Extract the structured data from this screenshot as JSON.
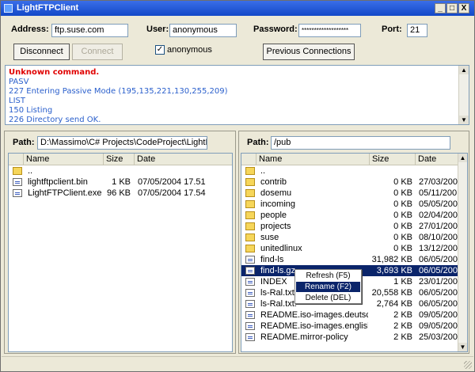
{
  "window": {
    "title": "LightFTPClient",
    "controls": {
      "minimize": "_",
      "maximize": "□",
      "close": "X"
    }
  },
  "connection": {
    "address_label": "Address:",
    "address_value": "ftp.suse.com",
    "user_label": "User:",
    "user_value": "anonymous",
    "password_label": "Password:",
    "password_value": "*******************",
    "port_label": "Port:",
    "port_value": "21",
    "anonymous_label": "anonymous",
    "anonymous_checked": "✓",
    "disconnect_label": "Disconnect",
    "connect_label": "Connect",
    "previous_label": "Previous Connections"
  },
  "log": [
    {
      "text": "Unknown command.",
      "color": "#e00000",
      "bold": true
    },
    {
      "text": "PASV",
      "color": "#2a5fcc",
      "bold": false
    },
    {
      "text": "227 Entering Passive Mode (195,135,221,130,255,209)",
      "color": "#2a5fcc",
      "bold": false
    },
    {
      "text": "LIST",
      "color": "#2a5fcc",
      "bold": false
    },
    {
      "text": "150 Listing",
      "color": "#2a5fcc",
      "bold": false
    },
    {
      "text": "226 Directory send OK.",
      "color": "#2a5fcc",
      "bold": false
    }
  ],
  "local": {
    "path_label": "Path:",
    "path_value": "D:\\Massimo\\C# Projects\\CodeProject\\LightFTPClient\\",
    "columns": [
      "Name",
      "Size",
      "Date"
    ],
    "rows": [
      {
        "icon": "folder",
        "name": "..",
        "size": "",
        "date": ""
      },
      {
        "icon": "file",
        "name": "lightftpclient.bin",
        "size": "1 KB",
        "date": "07/05/2004 17.51"
      },
      {
        "icon": "file",
        "name": "LightFTPClient.exe",
        "size": "96 KB",
        "date": "07/05/2004 17.54"
      }
    ]
  },
  "remote": {
    "path_label": "Path:",
    "path_value": "/pub",
    "columns": [
      "Name",
      "Size",
      "Date"
    ],
    "rows": [
      {
        "icon": "folder",
        "name": "..",
        "size": "",
        "date": ""
      },
      {
        "icon": "folder",
        "name": "contrib",
        "size": "0 KB",
        "date": "27/03/200"
      },
      {
        "icon": "folder",
        "name": "dosemu",
        "size": "0 KB",
        "date": "05/11/200"
      },
      {
        "icon": "folder",
        "name": "incoming",
        "size": "0 KB",
        "date": "05/05/200"
      },
      {
        "icon": "folder",
        "name": "people",
        "size": "0 KB",
        "date": "02/04/200"
      },
      {
        "icon": "folder",
        "name": "projects",
        "size": "0 KB",
        "date": "27/01/200"
      },
      {
        "icon": "folder",
        "name": "suse",
        "size": "0 KB",
        "date": "08/10/200"
      },
      {
        "icon": "folder",
        "name": "unitedlinux",
        "size": "0 KB",
        "date": "13/12/200"
      },
      {
        "icon": "file",
        "name": "find-ls",
        "size": "31,982 KB",
        "date": "06/05/200"
      },
      {
        "icon": "file",
        "name": "find-ls.gz",
        "size": "3,693 KB",
        "date": "06/05/200",
        "selected": true
      },
      {
        "icon": "file",
        "name": "INDEX",
        "size": "1 KB",
        "date": "23/01/200"
      },
      {
        "icon": "file",
        "name": "ls-Ral.txt",
        "size": "20,558 KB",
        "date": "06/05/200"
      },
      {
        "icon": "file",
        "name": "ls-Ral.txt.",
        "size": "2,764 KB",
        "date": "06/05/200"
      },
      {
        "icon": "file",
        "name": "README.iso-images.deutsch",
        "size": "2 KB",
        "date": "09/05/200"
      },
      {
        "icon": "file",
        "name": "README.iso-images.english",
        "size": "2 KB",
        "date": "09/05/200"
      },
      {
        "icon": "file",
        "name": "README.mirror-policy",
        "size": "2 KB",
        "date": "25/03/200"
      }
    ]
  },
  "context_menu": [
    {
      "label": "Refresh (F5)",
      "active": false
    },
    {
      "label": "Rename (F2)",
      "active": true
    },
    {
      "label": "Delete (DEL)",
      "active": false
    }
  ],
  "colors": {
    "titlebar": "#1f56d4",
    "selection": "#0a246a",
    "log_error": "#e00000",
    "log_info": "#2a5fcc"
  }
}
